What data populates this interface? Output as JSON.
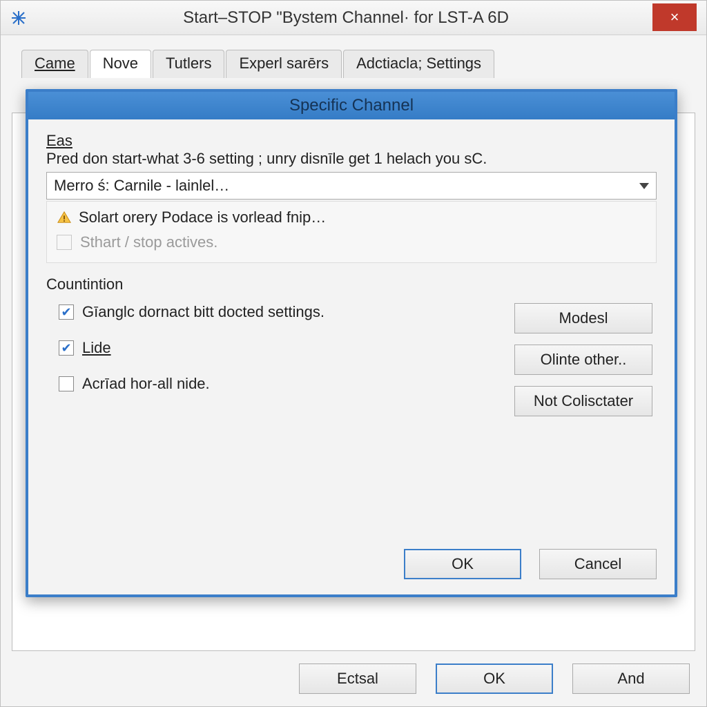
{
  "outer": {
    "title": "Start–STOP \"Bystem Channel· for LST-A 6D",
    "close_label": "×",
    "tabs": [
      "Came",
      "Nove",
      "Tutlers",
      "Experl sarērs",
      "Adctiacla; Settings"
    ],
    "active_tab_index": 1,
    "footer": {
      "extra_label": "Ectsal",
      "ok_label": "OK",
      "and_label": "And"
    }
  },
  "inner": {
    "title": "Specific Channel",
    "eas_label": "Eas",
    "desc": "Pred don start-what 3-6 setting ; unry disnīle get 1 helach you sC.",
    "combo_value": "Merro ś: Carnile - lainlel…",
    "warning_text": "Solart orery Podace is vorlead fnip…",
    "disabled_check_label": "Sthart / stop actives.",
    "count_label": "Countintion",
    "checks": [
      {
        "label": "Gīanglc dornact bitt docted settings.",
        "checked": true
      },
      {
        "label": "Lide",
        "checked": true,
        "ul_first": true
      },
      {
        "label": "Acrīad hor-all nide.",
        "checked": false
      }
    ],
    "side_buttons": [
      "Modesl",
      "Olinte other..",
      "Not Colisctater"
    ],
    "footer": {
      "ok_label": "OK",
      "cancel_label": "Cancel"
    }
  }
}
